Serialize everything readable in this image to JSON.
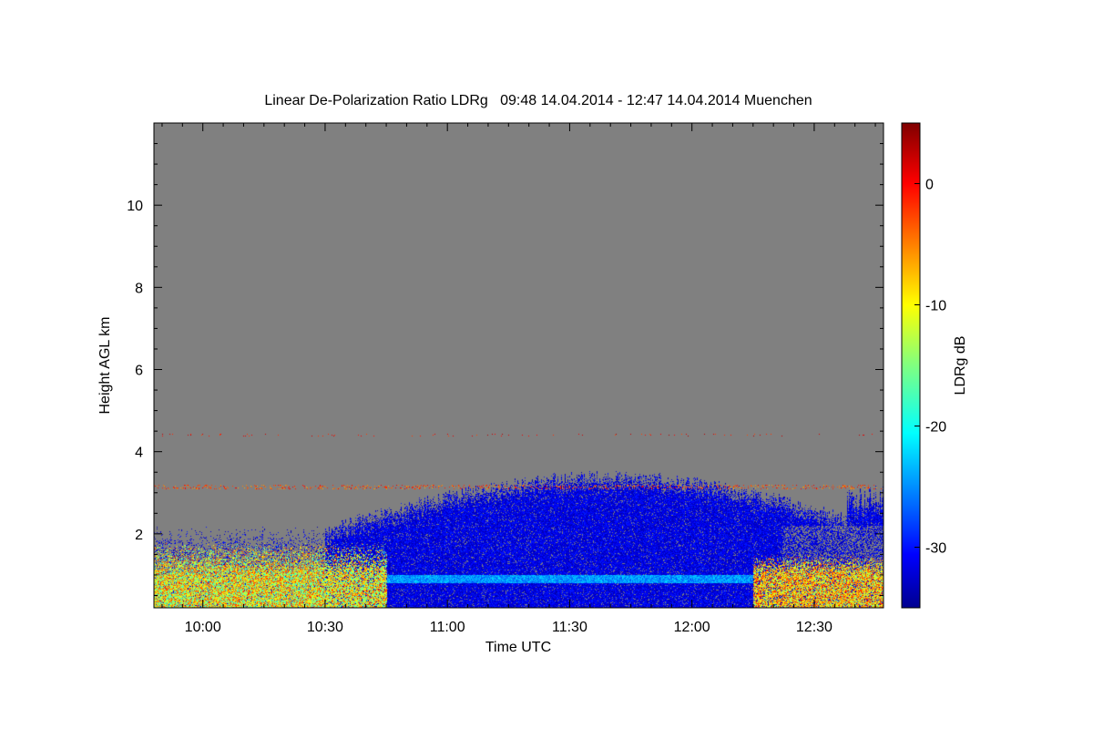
{
  "chart_data": {
    "type": "heatmap",
    "title": "Linear De-Polarization Ratio LDRg   09:48 14.04.2014 - 12:47 14.04.2014 Muenchen",
    "xlabel": "Time UTC",
    "ylabel": "Height AGL km",
    "xlim": [
      "09:48",
      "12:47"
    ],
    "ylim": [
      0.2,
      12
    ],
    "x_ticks": [
      {
        "label": "10:00",
        "minutes": 600
      },
      {
        "label": "10:30",
        "minutes": 630
      },
      {
        "label": "11:00",
        "minutes": 660
      },
      {
        "label": "11:30",
        "minutes": 690
      },
      {
        "label": "12:00",
        "minutes": 720
      },
      {
        "label": "12:30",
        "minutes": 750
      }
    ],
    "y_ticks": [
      2,
      4,
      6,
      8,
      10
    ],
    "colorbar": {
      "label": "LDRg dB",
      "range": [
        -35,
        5
      ],
      "ticks": [
        0,
        -10,
        -20,
        -30
      ],
      "colormap": "jet"
    },
    "background_color": "#808080",
    "signal_regions": [
      {
        "name": "near-surface high LDR layer",
        "time_start": "09:48",
        "time_end": "10:45",
        "height_bottom": 0.2,
        "height_top": 1.0,
        "ldr_db": -12
      },
      {
        "name": "low cloud / aerosol band",
        "time_start": "10:45",
        "time_end": "12:15",
        "height_bottom": 0.8,
        "height_top": 1.0,
        "ldr_db": -24
      },
      {
        "name": "main low-LDR region",
        "time_start": "10:30",
        "time_end": "12:43",
        "height_bottom": 0.3,
        "height_top": 3.4,
        "ldr_db": -31
      },
      {
        "name": "late near-surface high LDR",
        "time_start": "12:15",
        "time_end": "12:47",
        "height_bottom": 0.2,
        "height_top": 1.5,
        "ldr_db": -8
      },
      {
        "name": "sparse echoes at 3.15 km",
        "time_start": "09:48",
        "time_end": "12:47",
        "height_bottom": 3.1,
        "height_top": 3.2,
        "ldr_db": -3
      },
      {
        "name": "sparse echoes at 4.4 km",
        "time_start": "10:15",
        "time_end": "12:47",
        "height_bottom": 4.38,
        "height_top": 4.45,
        "ldr_db": 0
      }
    ]
  }
}
